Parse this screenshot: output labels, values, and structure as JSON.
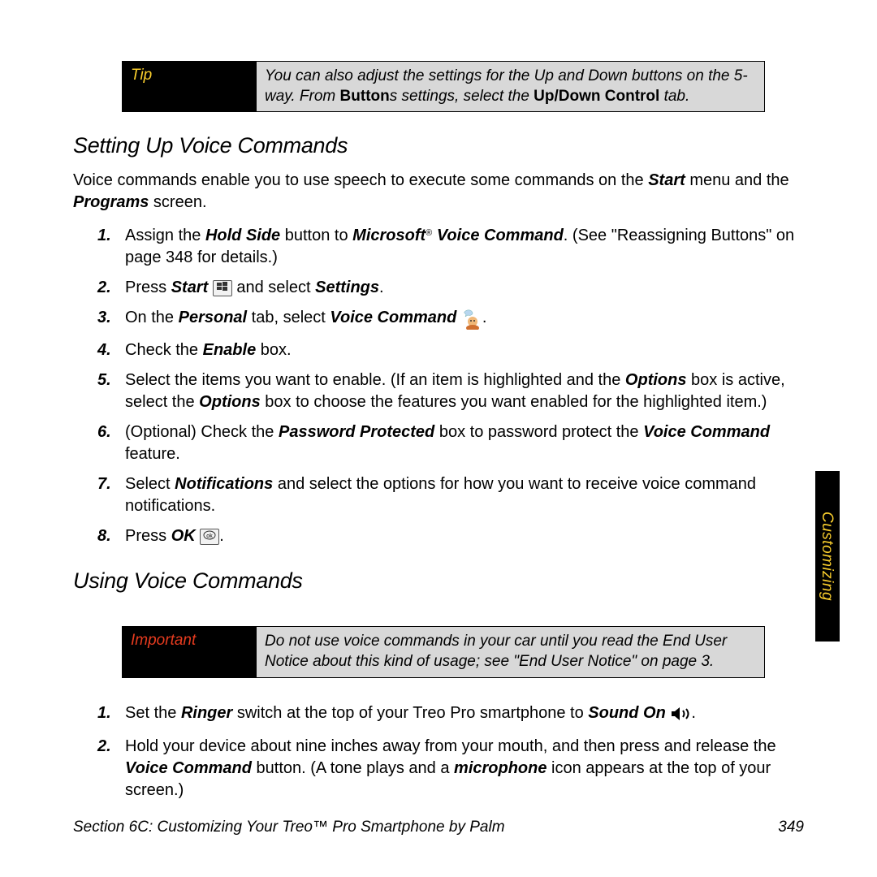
{
  "side_tab": "Customizing",
  "tip_box": {
    "label": "Tip",
    "text_html": "You can also adjust the settings for the Up and Down buttons on the 5-way. From <b>Button</b>s settings, select the <b>Up/Down Control</b> tab."
  },
  "heading1": "Setting Up Voice Commands",
  "para1_html": "Voice commands enable you to use speech to execute some commands on the <b><i>Start</i></b> menu and the <b><i>Programs</i></b> screen.",
  "steps1": [
    "Assign the <span class='bi'>Hold Side</span> button to <span class='bi'>Microsoft</span><sup class='reg'>®</sup> <span class='bi'>Voice Command</span>. (See \"Reassigning Buttons\" on page 348 for details.)",
    "Press <span class='bi'>Start</span> {WIN} and select <span class='bi'>Settings</span>.",
    "On the <span class='bi'>Personal</span> tab, select <span class='bi'>Voice Command</span> {VOICE}.",
    "Check the <span class='bi'>Enable</span> box.",
    "Select the items you want to enable. (If an item is highlighted and the <span class='bi'>Options</span> box is active, select the <span class='bi'>Options</span> box to choose the features you want enabled for the highlighted item.)",
    "(Optional) Check the <span class='bi'>Password Protected</span> box to password protect the <span class='bi'>Voice Command</span> feature.",
    "Select <span class='bi'>Notifications</span> and select the options for how you want to receive voice command notifications.",
    "Press <span class='bi'>OK</span> {OK}."
  ],
  "heading2": "Using Voice Commands",
  "important_box": {
    "label": "Important",
    "text_html": "Do not use voice commands in your car until you read the End User Notice about this kind of usage; see \"End User Notice\" on page 3."
  },
  "steps2": [
    "Set the <span class='bi'>Ringer</span> switch at the top of your Treo Pro smartphone to <span class='bi'>Sound On</span> {SOUND}.",
    "Hold your device about nine inches away from your mouth, and then press and release the <span class='bi'>Voice Command</span> button. (A tone plays and a <span class='bi'>microphone</span> icon appears at the top of your screen.)"
  ],
  "footer_left": "Section 6C: Customizing Your Treo™ Pro Smartphone by Palm",
  "footer_right": "349"
}
